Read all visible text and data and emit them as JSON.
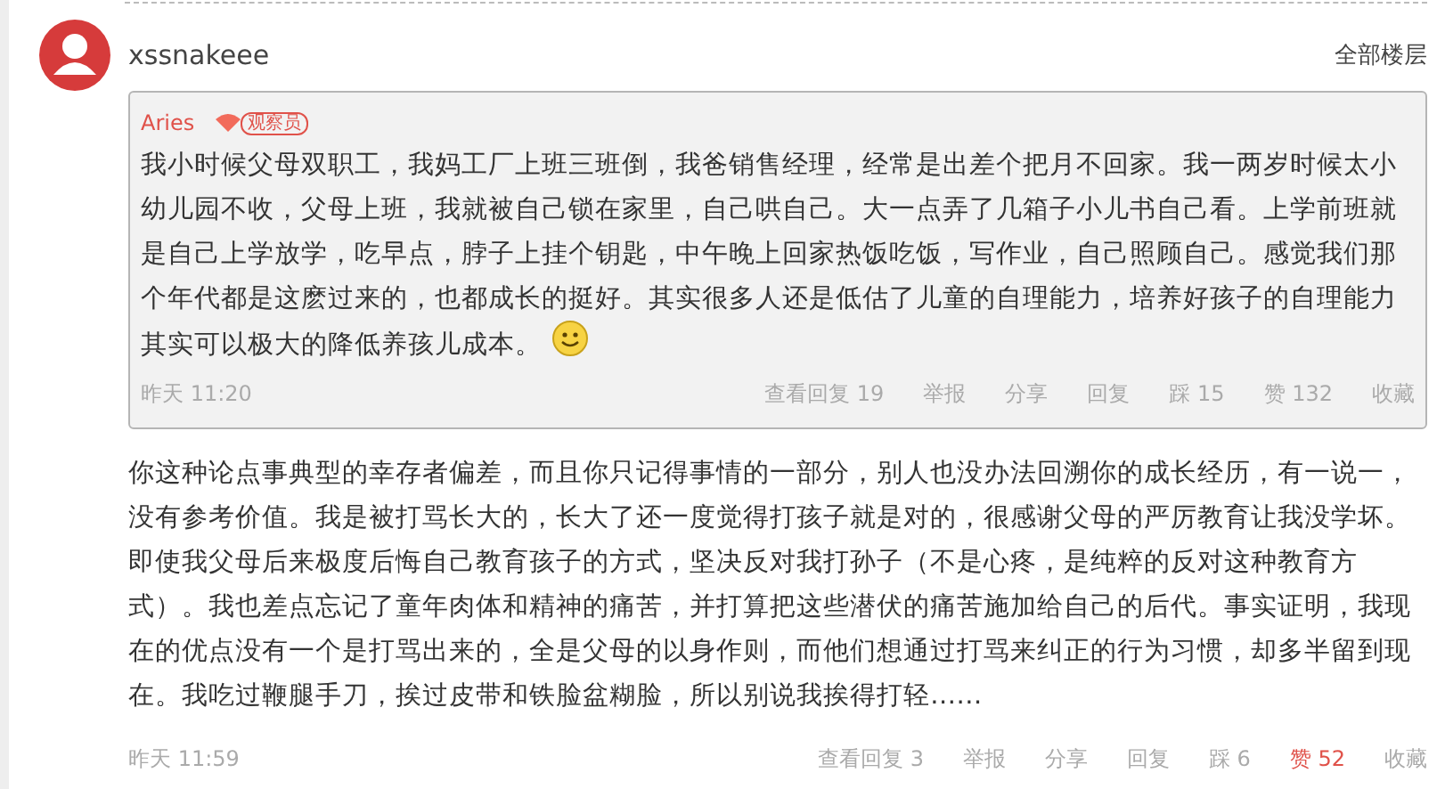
{
  "post": {
    "username": "xssnakeee",
    "floor_link": "全部楼层"
  },
  "quote": {
    "author": "Aries",
    "badge": "观察员",
    "text": "我小时候父母双职工，我妈工厂上班三班倒，我爸销售经理，经常是出差个把月不回家。我一两岁时候太小幼儿园不收，父母上班，我就被自己锁在家里，自己哄自己。大一点弄了几箱子小儿书自己看。上学前班就是自己上学放学，吃早点，脖子上挂个钥匙，中午晚上回家热饭吃饭，写作业，自己照顾自己。感觉我们那个年代都是这麽过来的，也都成长的挺好。其实很多人还是低估了儿童的自理能力，培养好孩子的自理能力其实可以极大的降低养孩儿成本。",
    "time": "昨天 11:20",
    "actions": [
      {
        "label": "查看回复 19",
        "selected": false
      },
      {
        "label": "举报",
        "selected": false
      },
      {
        "label": "分享",
        "selected": false
      },
      {
        "label": "回复",
        "selected": false
      },
      {
        "label": "踩 15",
        "selected": false
      },
      {
        "label": "赞 132",
        "selected": false
      },
      {
        "label": "收藏",
        "selected": false
      }
    ]
  },
  "reply": {
    "text": "你这种论点事典型的幸存者偏差，而且你只记得事情的一部分，别人也没办法回溯你的成长经历，有一说一，没有参考价值。我是被打骂长大的，长大了还一度觉得打孩子就是对的，很感谢父母的严厉教育让我没学坏。即使我父母后来极度后悔自己教育孩子的方式，坚决反对我打孙子（不是心疼，是纯粹的反对这种教育方式）。我也差点忘记了童年肉体和精神的痛苦，并打算把这些潜伏的痛苦施加给自己的后代。事实证明，我现在的优点没有一个是打骂出来的，全是父母的以身作则，而他们想通过打骂来纠正的行为习惯，却多半留到现在。我吃过鞭腿手刀，挨过皮带和铁脸盆糊脸，所以别说我挨得打轻……",
    "time": "昨天 11:59",
    "actions": [
      {
        "label": "查看回复 3",
        "selected": false
      },
      {
        "label": "举报",
        "selected": false
      },
      {
        "label": "分享",
        "selected": false
      },
      {
        "label": "回复",
        "selected": false
      },
      {
        "label": "踩 6",
        "selected": false
      },
      {
        "label": "赞 52",
        "selected": true
      },
      {
        "label": "收藏",
        "selected": false
      }
    ]
  }
}
